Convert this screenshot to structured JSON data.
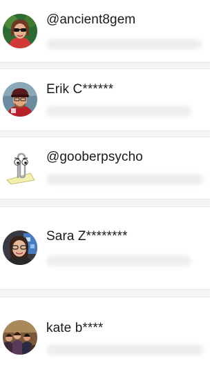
{
  "contacts": [
    {
      "name": "@ancient8gem",
      "email_redacted": true,
      "avatar": "woman-sunglasses-avatar"
    },
    {
      "name": "Erik C******",
      "email_redacted": true,
      "avatar": "man-cap-avatar"
    },
    {
      "name": "@gooberpsycho",
      "email_redacted": true,
      "avatar": "paperclip-avatar"
    },
    {
      "name": "Sara Z********",
      "email_redacted": true,
      "avatar": "woman-glasses-avatar"
    },
    {
      "name": "kate b****",
      "email_redacted": true,
      "avatar": "group-photo-avatar"
    }
  ]
}
